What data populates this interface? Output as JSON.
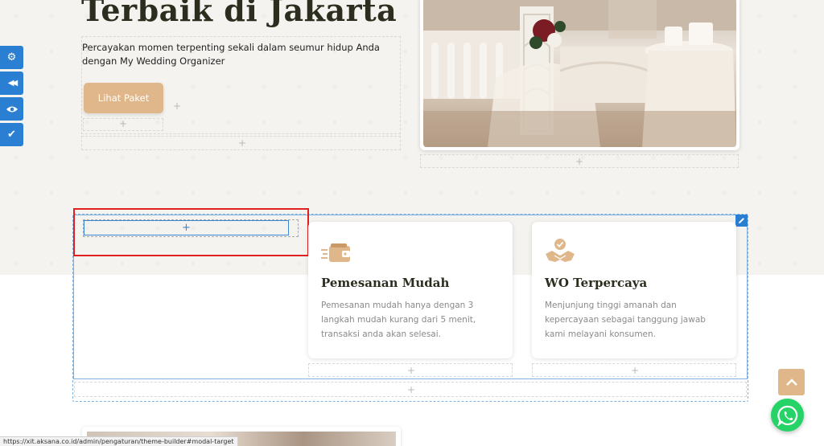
{
  "hero": {
    "headline": "Terbaik di Jakarta",
    "subtitle": "Percayakan momen terpenting sekali dalam seumur hidup Anda dengan My Wedding Organizer",
    "cta_label": "Lihat Paket"
  },
  "builder": {
    "plus": "+",
    "edit_icon": "pencil-icon"
  },
  "sidebar": {
    "items": [
      {
        "icon": "gears-icon",
        "glyph": "⚙"
      },
      {
        "icon": "backward-icon",
        "glyph": "◀◀"
      },
      {
        "icon": "eye-icon",
        "glyph": "👁"
      },
      {
        "icon": "check-icon",
        "glyph": "✔"
      }
    ]
  },
  "features": [
    {
      "icon": "wallet-icon",
      "title": "Pemesanan Mudah",
      "desc": "Pemesanan mudah hanya dengan 3 langkah mudah kurang dari 5 menit, transaksi anda akan selesai."
    },
    {
      "icon": "handshake-icon",
      "title": "WO Terpercaya",
      "desc": "Menjunjung tinggi amanah dan kepercayaan sebagai tanggung jawab kami melayani konsumen."
    }
  ],
  "floating": {
    "scroll_top_icon": "chevron-up-icon",
    "whatsapp_icon": "whatsapp-icon"
  },
  "status_bar": {
    "url": "https://xit.aksana.co.id/admin/pengaturan/theme-builder#modal-target"
  },
  "colors": {
    "accent": "#dfb78a",
    "heading": "#2b2e1e",
    "builder_blue": "#2b7fd2",
    "highlight_red": "#e02020",
    "whatsapp": "#25d366"
  }
}
